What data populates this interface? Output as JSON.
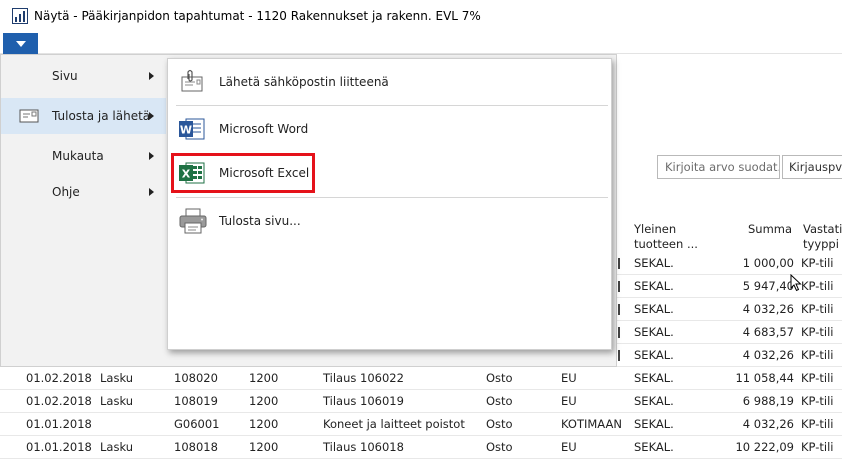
{
  "window": {
    "title": "Näytä - Pääkirjanpidon tapahtumat - 1120 Rakennukset ja rakenn. EVL 7%"
  },
  "filter": {
    "placeholder": "Kirjoita arvo suodat...",
    "field": "Kirjauspvm"
  },
  "columns": {
    "general_product": "Yleinen tuotteen ...",
    "amount": "Summa",
    "counter_type": "Vastatili tyyppi",
    "truncated_dot": "."
  },
  "menu": {
    "items": [
      {
        "label": "Sivu"
      },
      {
        "label": "Tulosta ja lähetä"
      },
      {
        "label": "Mukauta"
      },
      {
        "label": "Ohje"
      }
    ],
    "submenu": [
      {
        "label": "Lähetä sähköpostin liitteenä",
        "icon": "attachment-icon"
      },
      {
        "label": "Microsoft Word",
        "icon": "word-icon"
      },
      {
        "label": "Microsoft Excel",
        "icon": "excel-icon"
      },
      {
        "label": "Tulosta sivu...",
        "icon": "printer-icon"
      }
    ]
  },
  "rows_hidden": [
    {
      "product": "SEKAL.",
      "amount": "1 000,00",
      "type": "KP-tili"
    },
    {
      "product": "SEKAL.",
      "amount": "5 947,40",
      "type": "KP-tili"
    },
    {
      "product": "SEKAL.",
      "amount": "4 032,26",
      "type": "KP-tili"
    },
    {
      "product": "SEKAL.",
      "amount": "4 683,57",
      "type": "KP-tili"
    },
    {
      "product": "SEKAL.",
      "amount": "4 032,26",
      "type": "KP-tili"
    }
  ],
  "rows": [
    {
      "date": "01.02.2018",
      "doc_type": "Lasku",
      "doc_no": "108020",
      "account": "1200",
      "description": "Tilaus 106022",
      "posting": "Osto",
      "bus": "EU",
      "product": "SEKAL.",
      "amount": "11 058,44",
      "type": "KP-tili"
    },
    {
      "date": "01.02.2018",
      "doc_type": "Lasku",
      "doc_no": "108019",
      "account": "1200",
      "description": "Tilaus 106019",
      "posting": "Osto",
      "bus": "EU",
      "product": "SEKAL.",
      "amount": "6 988,19",
      "type": "KP-tili"
    },
    {
      "date": "01.01.2018",
      "doc_type": "",
      "doc_no": "G06001",
      "account": "1200",
      "description": "Koneet ja laitteet poistot",
      "posting": "Osto",
      "bus": "KOTIMAAN",
      "product": "SEKAL.",
      "amount": "4 032,26",
      "type": "KP-tili"
    },
    {
      "date": "01.01.2018",
      "doc_type": "Lasku",
      "doc_no": "108018",
      "account": "1200",
      "description": "Tilaus 106018",
      "posting": "Osto",
      "bus": "EU",
      "product": "SEKAL.",
      "amount": "10 222,09",
      "type": "KP-tili"
    }
  ],
  "colors": {
    "accent": "#1f5fad",
    "highlight": "#e5121a",
    "selected_bg": "#d9e7f5",
    "excel_green": "#1f7244",
    "word_blue": "#2b579a"
  }
}
